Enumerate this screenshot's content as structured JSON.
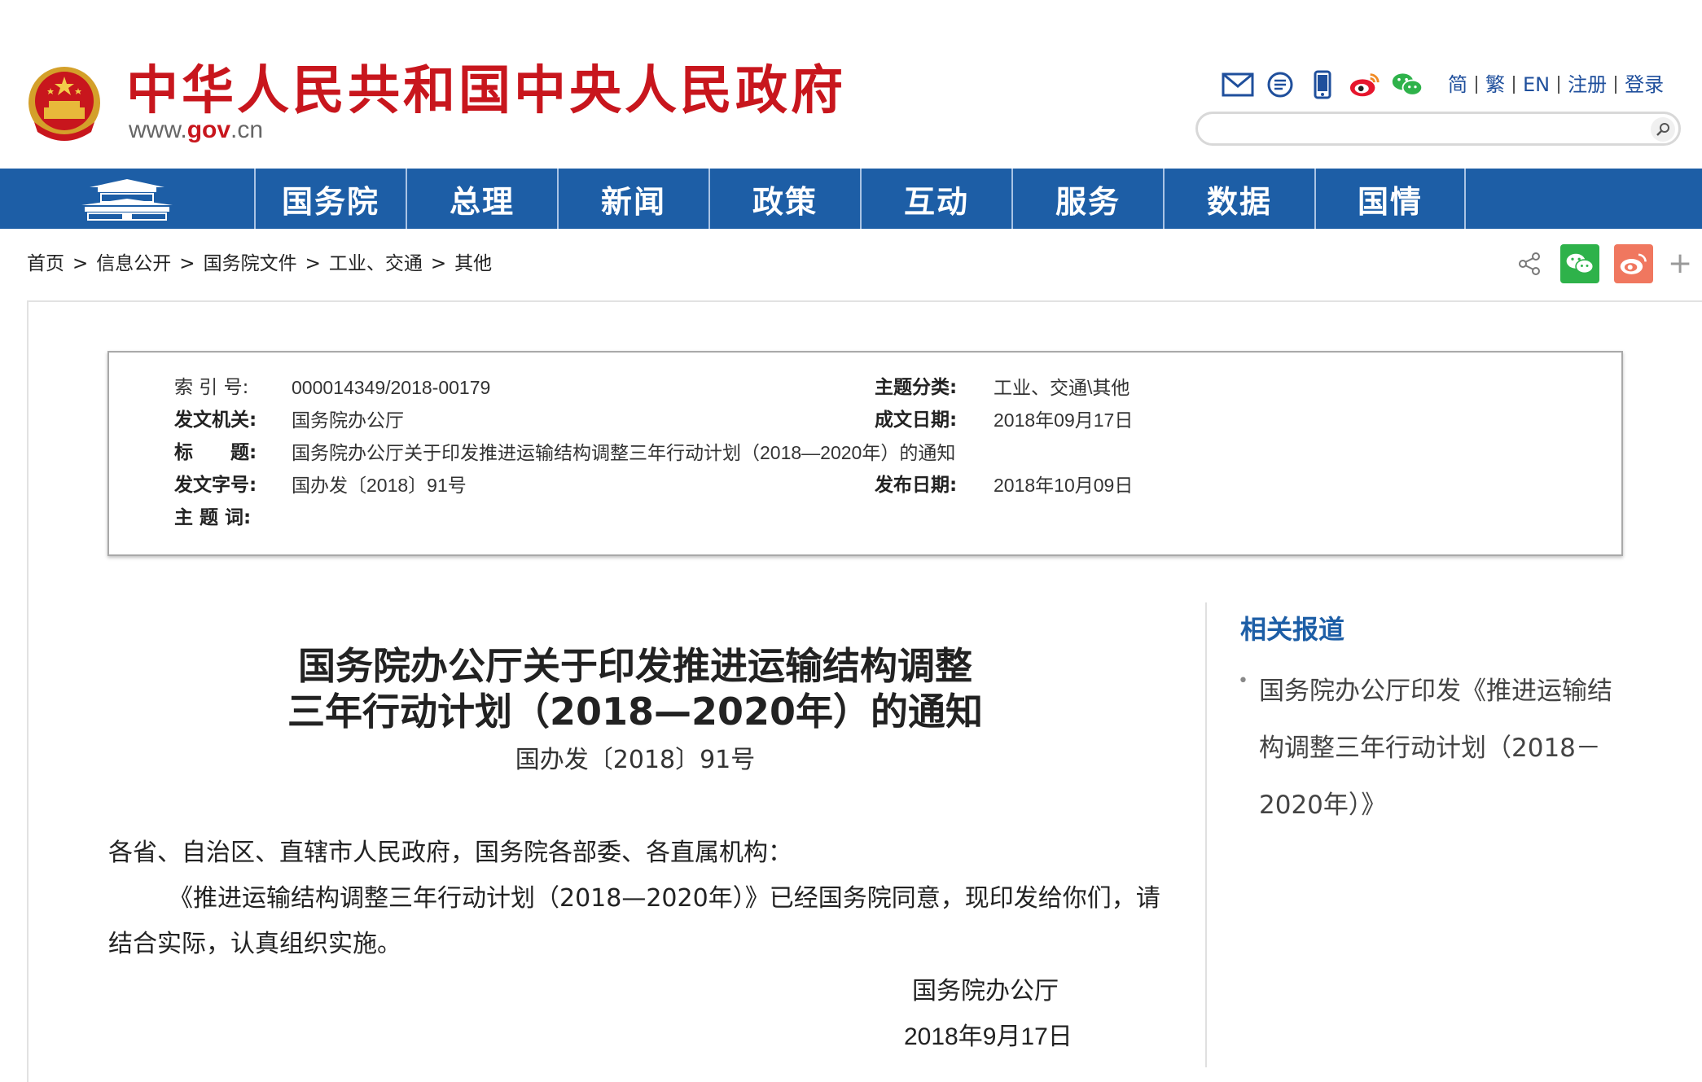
{
  "header": {
    "site_title": "中华人民共和国中央人民政府",
    "site_url_prefix": "www.",
    "site_url_highlight": "gov",
    "site_url_suffix": ".cn",
    "tool_icons": [
      "mail-icon",
      "message-icon",
      "mobile-icon",
      "weibo-icon",
      "wechat-icon"
    ],
    "lang_links": [
      "简",
      "繁",
      "EN",
      "注册",
      "登录"
    ],
    "search": {
      "value": "",
      "placeholder": ""
    }
  },
  "nav": {
    "items": [
      "国务院",
      "总理",
      "新闻",
      "政策",
      "互动",
      "服务",
      "数据",
      "国情"
    ]
  },
  "breadcrumb": {
    "items": [
      "首页",
      "信息公开",
      "国务院文件",
      "工业、交通",
      "其他"
    ],
    "separator": ">"
  },
  "share": {
    "plus_label": "+"
  },
  "meta": {
    "index_label": "索 引 号:",
    "index_value": "000014349/2018-00179",
    "topic_label": "主题分类:",
    "topic_value": "工业、交通\\其他",
    "issuer_label": "发文机关:",
    "issuer_value": "国务院办公厅",
    "written_label": "成文日期:",
    "written_value": "2018年09月17日",
    "title_label": "标　　题:",
    "title_value": "国务院办公厅关于印发推进运输结构调整三年行动计划（2018—2020年）的通知",
    "docno_label": "发文字号:",
    "docno_value": "国办发〔2018〕91号",
    "published_label": "发布日期:",
    "published_value": "2018年10月09日",
    "keywords_label": "主 题 词:",
    "keywords_value": ""
  },
  "article": {
    "title_line1": "国务院办公厅关于印发推进运输结构调整",
    "title_line2": "三年行动计划（2018—2020年）的通知",
    "doc_number": "国办发〔2018〕91号",
    "salutation": "各省、自治区、直辖市人民政府，国务院各部委、各直属机构：",
    "paragraph1": "《推进运输结构调整三年行动计划（2018—2020年）》已经国务院同意，现印发给你们，请结合实际，认真组织实施。",
    "signer": "国务院办公厅",
    "date": "2018年9月17日"
  },
  "related": {
    "title": "相关报道",
    "items": [
      "国务院办公厅印发《推进运输结构调整三年行动计划（2018－2020年）》"
    ]
  },
  "colors": {
    "brand_red": "#c8161d",
    "nav_blue": "#1d5ea6",
    "link_blue": "#1f4f9c",
    "wechat_green": "#2eb24a",
    "weibo_red": "#f0775f"
  }
}
